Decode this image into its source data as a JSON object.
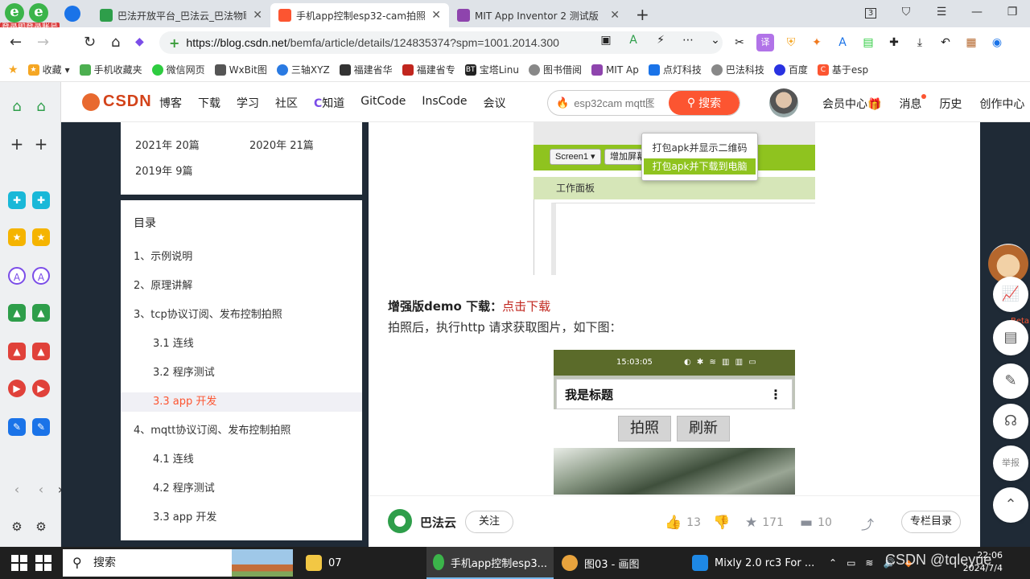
{
  "browser": {
    "login_badge": "登录即登录账号",
    "tabs": [
      {
        "title": "巴法开放平台_巴法云_巴法物联",
        "fav": "#2e9e4a"
      },
      {
        "title": "手机app控制esp32-cam拍照",
        "fav": "#fc5531"
      },
      {
        "title": "MIT App Inventor 2 测试版",
        "fav": "#8e44ad"
      }
    ],
    "new_tab": "+",
    "tab_count": "3",
    "url_domain": "https://blog.csdn.net",
    "url_path": "/bemfa/article/details/124835374?spm=1001.2014.300"
  },
  "bookmarks": [
    {
      "label": "收藏",
      "color": "#f5a623"
    },
    {
      "label": "手机收藏夹",
      "color": "#4caf50"
    },
    {
      "label": "微信网页",
      "color": "#2ecc40"
    },
    {
      "label": "WxBit图",
      "color": "#555555"
    },
    {
      "label": "三轴XYZ",
      "color": "#2a7ae2"
    },
    {
      "label": "福建省华",
      "color": "#333333"
    },
    {
      "label": "福建省专",
      "color": "#c1261e"
    },
    {
      "label": "宝塔Linu",
      "color": "#222222"
    },
    {
      "label": "图书借阅",
      "color": "#888888"
    },
    {
      "label": "MIT Ap",
      "color": "#8e44ad"
    },
    {
      "label": "点灯科技",
      "color": "#1a73e8"
    },
    {
      "label": "巴法科技",
      "color": "#888888"
    },
    {
      "label": "百度",
      "color": "#2932e1"
    },
    {
      "label": "基于esp",
      "color": "#fc5531"
    }
  ],
  "csdn": {
    "logo": "CSDN",
    "nav": [
      "博客",
      "下载",
      "学习",
      "社区",
      "知道",
      "GitCode",
      "InsCode",
      "会议"
    ],
    "search_placeholder": "esp32cam mqtt图",
    "search_button": "搜索",
    "header_links": [
      "会员中心",
      "消息",
      "历史",
      "创作中心"
    ]
  },
  "archive": {
    "rows": [
      [
        "2021年 20篇",
        "2020年 21篇"
      ],
      [
        "2019年 9篇",
        ""
      ]
    ]
  },
  "toc": {
    "heading": "目录",
    "items": [
      {
        "label": "1、示例说明",
        "level": 1,
        "active": false
      },
      {
        "label": "2、原理讲解",
        "level": 1,
        "active": false
      },
      {
        "label": "3、tcp协议订阅、发布控制拍照",
        "level": 1,
        "active": false
      },
      {
        "label": "3.1 连线",
        "level": 2,
        "active": false
      },
      {
        "label": "3.2 程序测试",
        "level": 2,
        "active": false
      },
      {
        "label": "3.3 app 开发",
        "level": 2,
        "active": true
      },
      {
        "label": "4、mqtt协议订阅、发布控制拍照",
        "level": 1,
        "active": false
      },
      {
        "label": "4.1 连线",
        "level": 2,
        "active": false
      },
      {
        "label": "4.2 程序测试",
        "level": 2,
        "active": false
      },
      {
        "label": "3.3 app 开发",
        "level": 2,
        "active": false
      }
    ]
  },
  "article": {
    "mit_screen_button": "Screen1 ▾",
    "mit_add_screen": "增加屏幕",
    "mit_panel": "工作面板",
    "mit_popup": [
      "打包apk并显示二维码",
      "打包apk并下载到电脑"
    ],
    "demo_label": "增强版demo 下载：",
    "demo_link": "点击下载",
    "desc": "拍照后，执行http 请求获取图片，如下图：",
    "phone": {
      "time": "15:03:05",
      "title": "我是标题",
      "btn_photo": "拍照",
      "btn_refresh": "刷新"
    }
  },
  "actions": {
    "author": "巴法云",
    "follow": "关注",
    "likes": "13",
    "favorites": "171",
    "comments": "10",
    "column": "专栏目录"
  },
  "right_tools": {
    "beta": "Beta",
    "report": "举报"
  },
  "taskbar": {
    "search": "搜索",
    "items": [
      {
        "label": "07",
        "color": "#f2c744"
      },
      {
        "label": "手机app控制esp3...",
        "color": "#3bb44a"
      },
      {
        "label": "图03 - 画图",
        "color": "#e8a33d"
      },
      {
        "label": "Mixly 2.0 rc3 For ...",
        "color": "#1e88e5"
      }
    ],
    "time": "22:06",
    "date": "2024/7/4"
  },
  "watermark": "CSDN @tqleyue"
}
